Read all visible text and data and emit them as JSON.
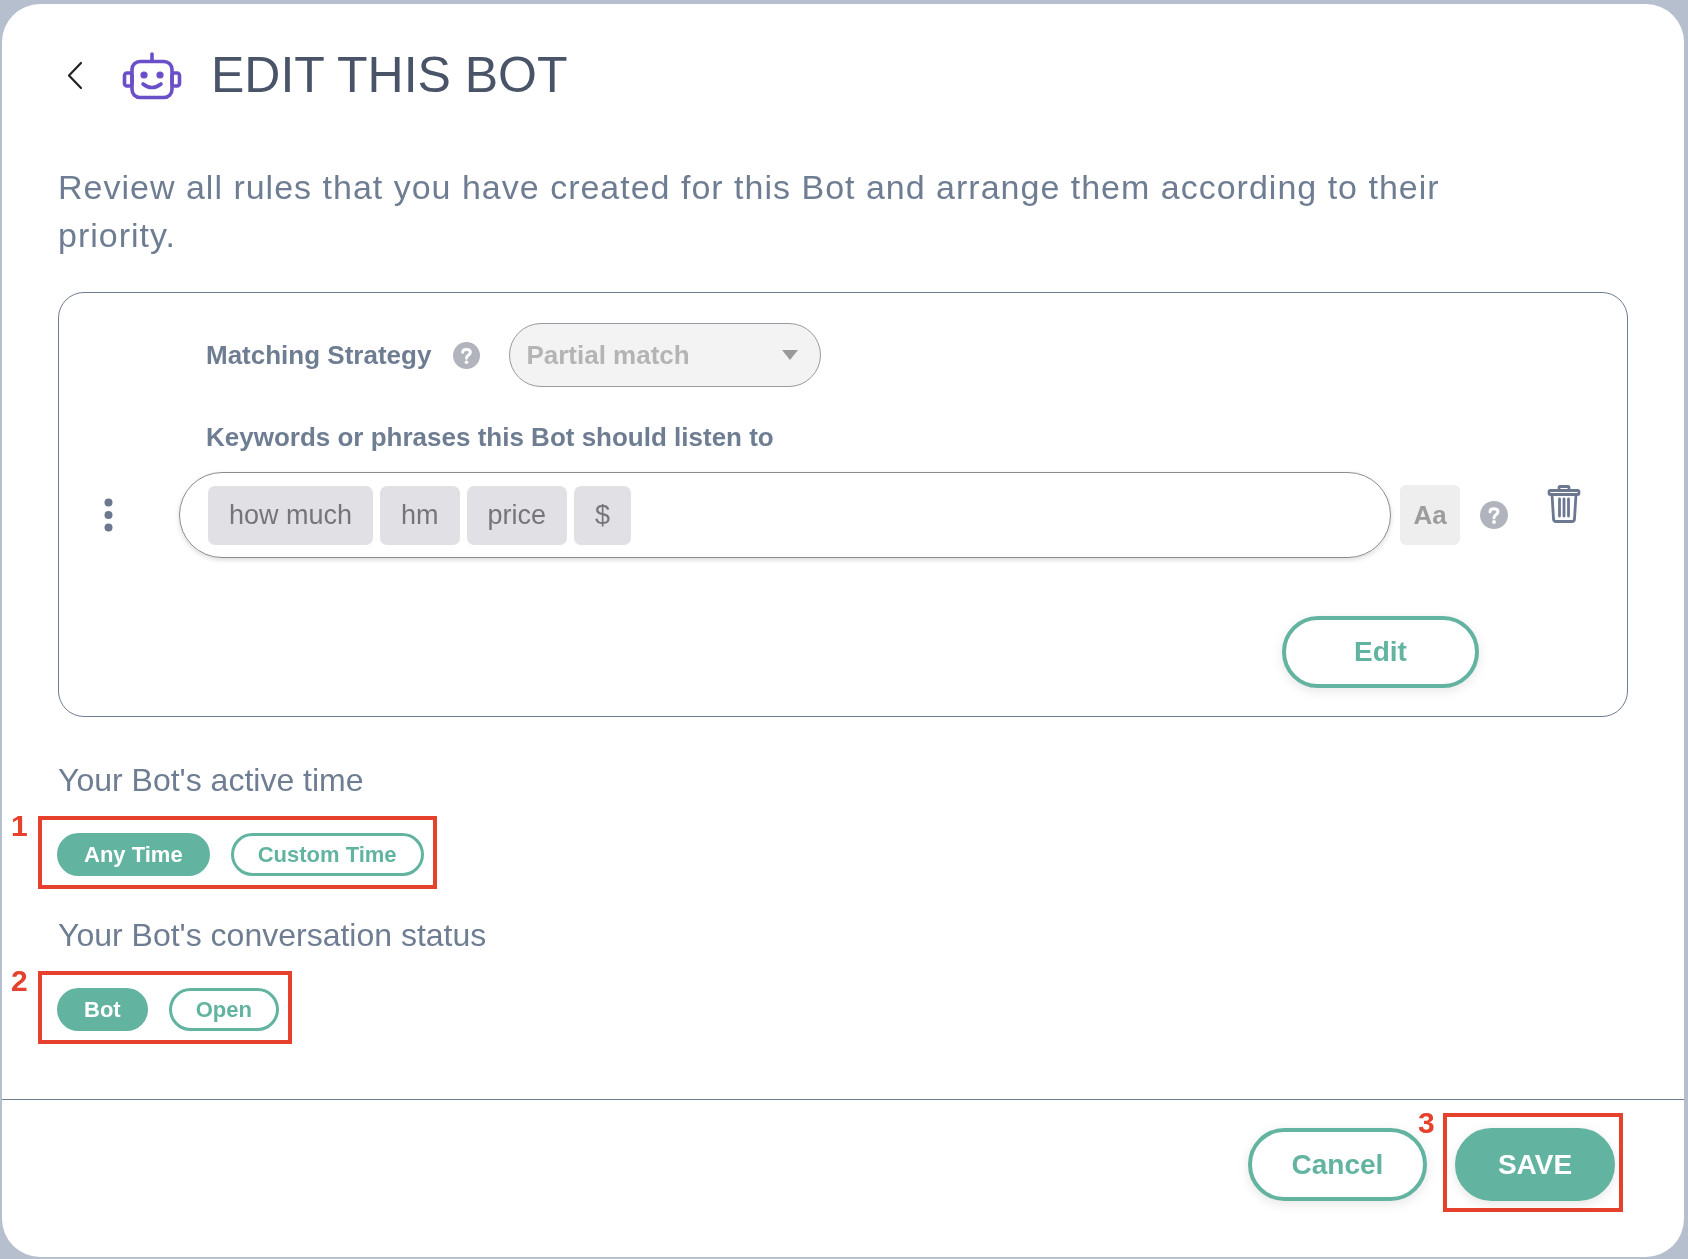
{
  "header": {
    "title": "EDIT THIS BOT"
  },
  "description": "Review all rules that you have created for this Bot and arrange them according to their priority.",
  "rule": {
    "matching_strategy": {
      "label": "Matching Strategy",
      "value": "Partial match",
      "disabled": true
    },
    "keywords": {
      "label": "Keywords or phrases this Bot should listen to",
      "tags": [
        "how much",
        "hm",
        "price",
        "$"
      ]
    },
    "case_sensitive": {
      "label": "Aa",
      "on": false
    },
    "edit_button": "Edit"
  },
  "active_time": {
    "label": "Your Bot's active time",
    "annotation": "1",
    "options": [
      {
        "label": "Any Time",
        "selected": true
      },
      {
        "label": "Custom Time",
        "selected": false
      }
    ]
  },
  "conversation_status": {
    "label": "Your Bot's conversation status",
    "annotation": "2",
    "options": [
      {
        "label": "Bot",
        "selected": true
      },
      {
        "label": "Open",
        "selected": false
      }
    ]
  },
  "footer": {
    "buttons": [
      {
        "label": "Cancel",
        "kind": "outline"
      },
      {
        "label": "SAVE",
        "kind": "primary",
        "annotation": "3"
      }
    ]
  }
}
